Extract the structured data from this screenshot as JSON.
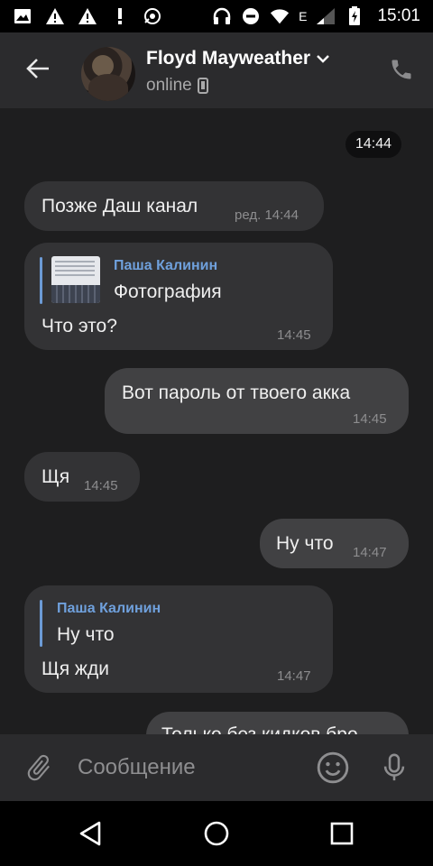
{
  "status_bar": {
    "time": "15:01",
    "network": "E"
  },
  "header": {
    "name": "Floyd Mayweather",
    "status": "online"
  },
  "chat": {
    "date_chip": "14:44",
    "messages": [
      {
        "text": "Позже Даш канал",
        "time": "ред. 14:44"
      },
      {
        "reply_author": "Паша Калинин",
        "reply_text": "Фотография",
        "text": "Что это?",
        "time": "14:45"
      },
      {
        "text": "Вот пароль от твоего акка",
        "time": "14:45"
      },
      {
        "text": "Щя",
        "time": "14:45"
      },
      {
        "text": "Ну что",
        "time": "14:47"
      },
      {
        "reply_author": "Паша Калинин",
        "reply_text": "Ну что",
        "text": "Щя жди",
        "time": "14:47"
      },
      {
        "text": "Только без кидков бро",
        "time": ""
      }
    ]
  },
  "composer": {
    "placeholder": "Сообщение"
  },
  "icons": {
    "back": "arrow-left-icon",
    "call": "phone-icon",
    "attach": "paperclip-icon",
    "emoji": "smiley-icon",
    "mic": "microphone-icon",
    "nav_back": "triangle-back-icon",
    "nav_home": "circle-home-icon",
    "nav_recents": "square-recents-icon"
  },
  "colors": {
    "reply_accent": "#6fa0dc",
    "background": "#1e1e1f",
    "header": "#2b2b2d"
  }
}
